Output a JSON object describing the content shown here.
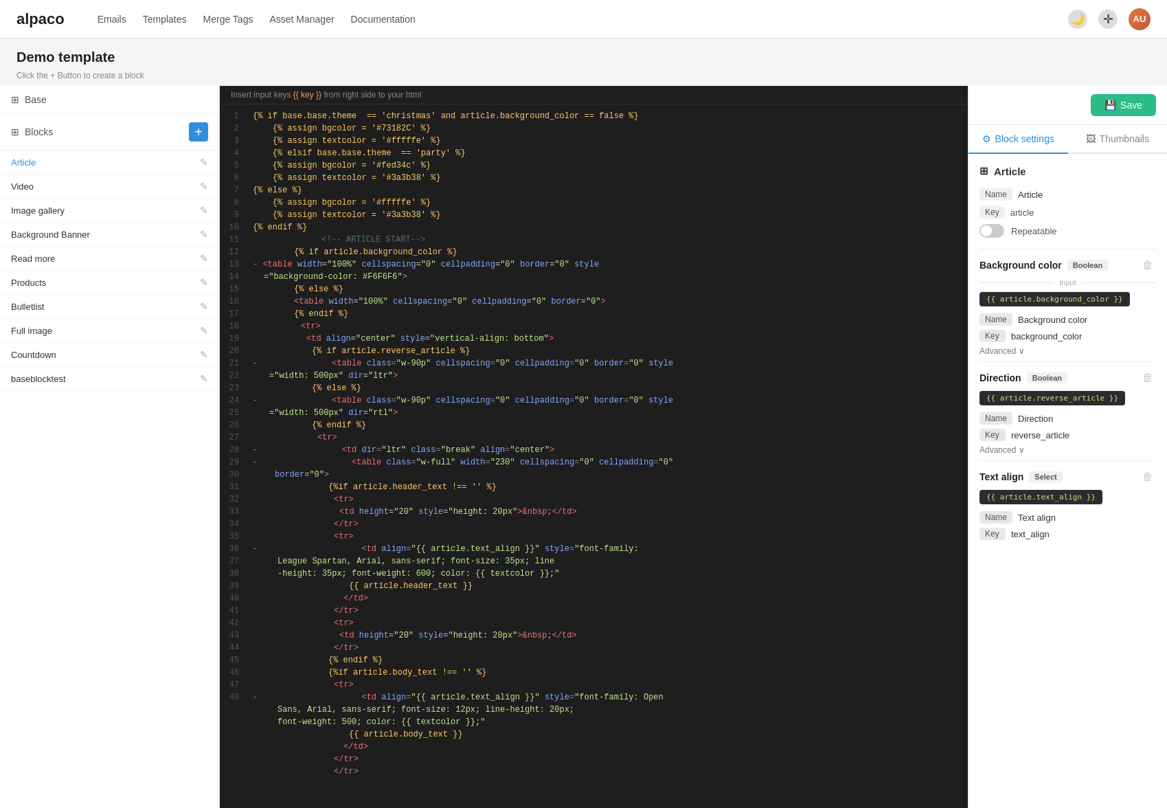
{
  "nav": {
    "logo": "alpaco",
    "links": [
      "Emails",
      "Templates",
      "Merge Tags",
      "Asset Manager",
      "Documentation"
    ],
    "moon_icon": "🌙",
    "crosshair_icon": "✛",
    "avatar_text": "AU"
  },
  "page": {
    "title": "Demo template",
    "hint": "Click the + Button to create a block"
  },
  "sidebar": {
    "base_label": "Base",
    "blocks_label": "Blocks",
    "add_tooltip": "+",
    "items": [
      {
        "name": "Article",
        "active": true
      },
      {
        "name": "Video",
        "active": false
      },
      {
        "name": "Image gallery",
        "active": false
      },
      {
        "name": "Background Banner",
        "active": false
      },
      {
        "name": "Read more",
        "active": false
      },
      {
        "name": "Products",
        "active": false
      },
      {
        "name": "Bulletlist",
        "active": false
      },
      {
        "name": "Full image",
        "active": false
      },
      {
        "name": "Countdown",
        "active": false
      },
      {
        "name": "baseblocktest",
        "active": false
      }
    ]
  },
  "editor": {
    "hint_prefix": "Insert input keys",
    "hint_code": "{{ key }}",
    "hint_suffix": "from right side to your html",
    "lines": [
      "{% if base.base.theme  == 'christmas' and article.background_color == false %}",
      "    {% assign bgcolor = '#73182C' %}",
      "    {% assign textcolor = '#fffffe' %}",
      "",
      "    {% elsif base.base.theme  == 'party' %}",
      "    {% assign bgcolor = '#fed34c' %}",
      "    {% assign textcolor = '#3a3b38' %}",
      "",
      "{% else %}",
      "    {% assign bgcolor = '#fffffe' %}",
      "    {% assign textcolor = '#3a3b38' %}",
      "{% endif %}",
      "",
      "                        <!-- ARTICLE START-->",
      "            {% if article.background_color %}",
      "-           <table width=\"100%\" cellspacing=\"0\" cellpadding=\"0\" border=\"0\" style",
      "                =\"background-color: #F6F6F6\">",
      "            {% else %}",
      "            <table width=\"100%\" cellspacing=\"0\" cellpadding=\"0\" border=\"0\">",
      "            {% endif %}",
      "              <tr>",
      "                <td align=\"center\" style=\"vertical-align: bottom\">",
      "                    {% if article.reverse_article %}",
      "-                   <table class=\"w-90p\" cellspacing=\"0\" cellpadding=\"0\" border=\"0\" style",
      "                        =\"width: 500px\" dir=\"ltr\">",
      "                    {% else %}",
      "-                   <table class=\"w-90p\" cellspacing=\"0\" cellpadding=\"0\" border=\"0\" style",
      "                        =\"width: 500px\" dir=\"rtl\">",
      "                    {% endif %}",
      "                      <tr>",
      "-                       <td dir=\"ltr\" class=\"break\" align=\"center\">",
      "-                         <table class=\"w-full\" width=\"230\" cellspacing=\"0\" cellpadding=\"0\"",
      "                           border=\"0\">",
      "                            {%if article.header_text !== '' %}",
      "                              <tr>",
      "                                <td height=\"20\" style=\"height: 20px\">&nbsp;</td>",
      "                              </tr>",
      "                              <tr>",
      "-                               <td align=\"{{ article.text_align }}\" style=\"font-family:",
      "                                  League Spartan, Arial, sans-serif; font-size: 35px; line",
      "                                  -height: 35px; font-weight: 600; color: {{ textcolor }};\"",
      "                                  {{ article.header_text }}",
      "                                </td>",
      "                              </tr>",
      "                              <tr>",
      "                                <td height=\"20\" style=\"height: 20px\">&nbsp;</td>",
      "                              </tr>",
      "                            {% endif %}",
      "                            {%if article.body_text !== '' %}",
      "                              <tr>",
      "-                               <td align=\"{{ article.text_align }}\" style=\"font-family: Open",
      "                                  Sans, Arial, sans-serif; font-size: 12px; line-height: 20px;",
      "                                  font-weight: 500; color: {{ textcolor }};\"",
      "                                  {{ article.body_text }}",
      "                                </td>",
      "                              </tr>",
      "                            </tr>"
    ]
  },
  "right_panel": {
    "save_label": "Save",
    "tab_block_settings": "Block settings",
    "tab_thumbnails": "Thumbnails",
    "article_section": {
      "title": "Article",
      "name_label": "Name",
      "name_value": "Article",
      "key_label": "Key",
      "key_value": "article",
      "repeatable_label": "Repeatable"
    },
    "background_color_section": {
      "title": "Background color",
      "type": "Boolean",
      "input_divider": "Input",
      "tmpl_tag": "{{ article.background_color }}",
      "name_label": "Name",
      "name_value": "Background color",
      "key_label": "Key",
      "key_value": "background_color",
      "advanced_label": "Advanced"
    },
    "direction_section": {
      "title": "Direction",
      "type": "Boolean",
      "tmpl_tag": "{{ article.reverse_article }}",
      "name_label": "Name",
      "name_value": "Direction",
      "key_label": "Key",
      "key_value": "reverse_article",
      "advanced_label": "Advanced"
    },
    "text_align_section": {
      "title": "Text align",
      "type": "Select",
      "tmpl_tag": "{{ article.text_align }}",
      "name_label": "Name",
      "name_value": "Text align",
      "key_label": "Key",
      "key_value": "text_align"
    }
  }
}
